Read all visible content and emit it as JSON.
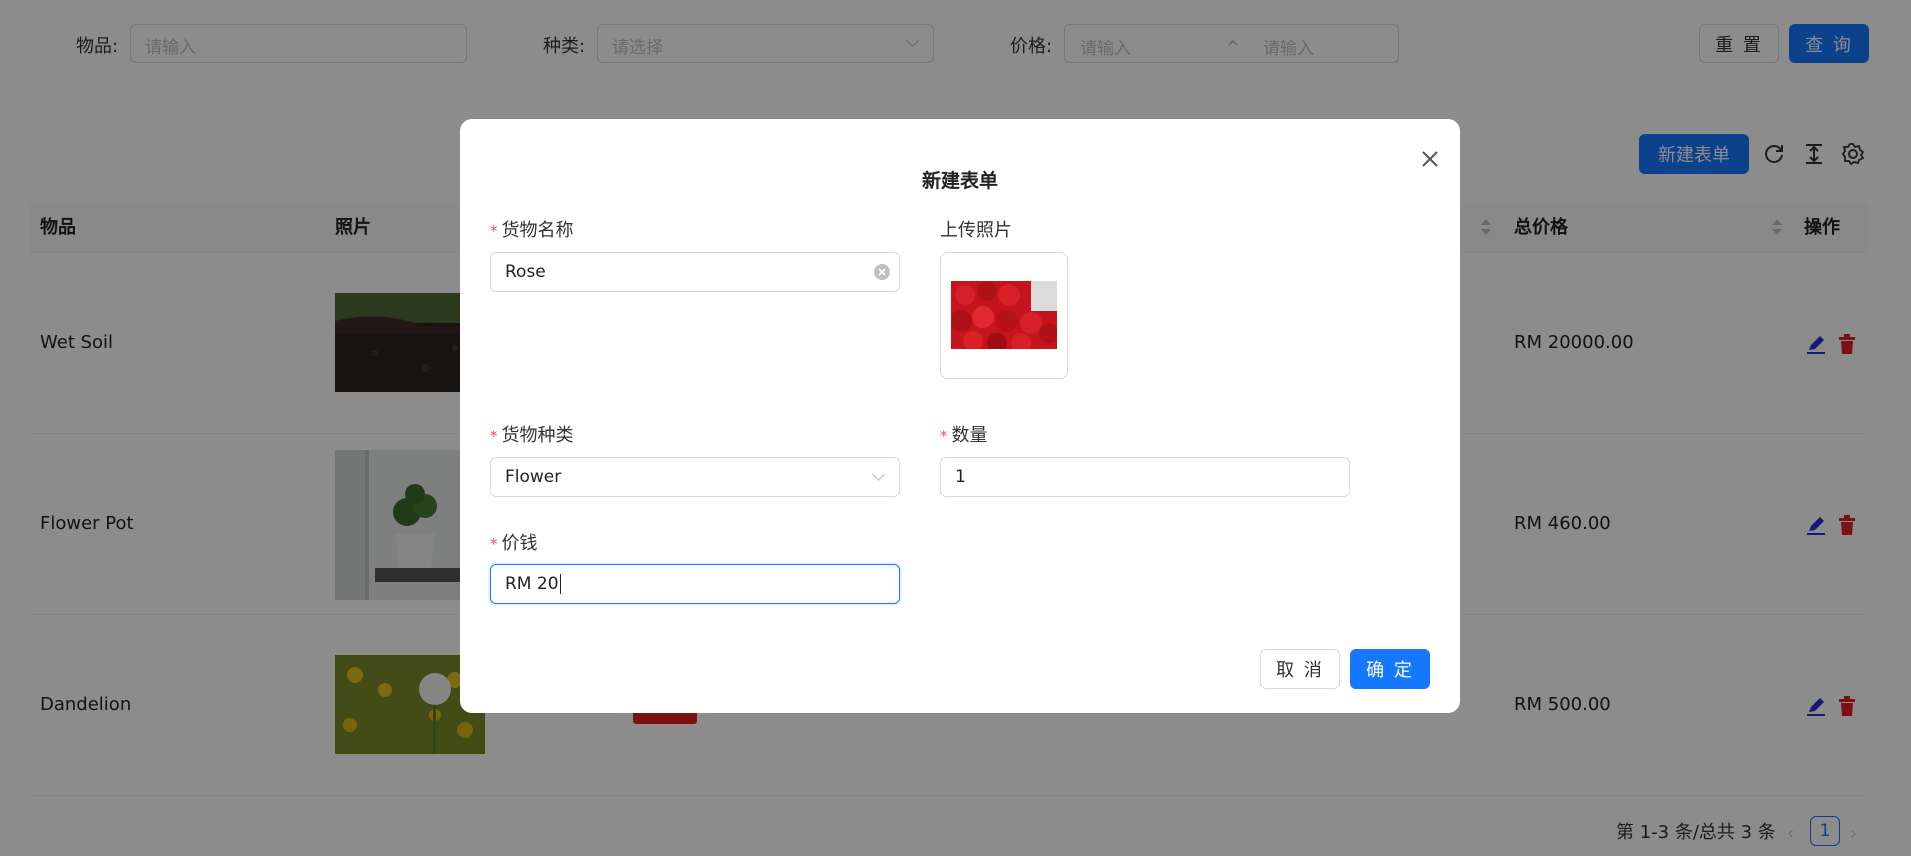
{
  "search": {
    "item_label": "物品:",
    "item_placeholder": "请输入",
    "category_label": "种类:",
    "category_placeholder": "请选择",
    "price_label": "价格:",
    "price_min_placeholder": "请输入",
    "price_max_placeholder": "请输入",
    "reset_label": "重 置",
    "query_label": "查 询"
  },
  "toolbar": {
    "new_label": "新建表单",
    "icons": [
      "reload-icon",
      "density-icon",
      "settings-icon"
    ]
  },
  "table": {
    "headers": {
      "item": "物品",
      "photo": "照片",
      "total_price": "总价格",
      "action": "操作"
    },
    "rows": [
      {
        "item": "Wet Soil",
        "total": "RM 20000.00"
      },
      {
        "item": "Flower Pot",
        "total": "RM 460.00"
      },
      {
        "item": "Dandelion",
        "total": "RM 500.00"
      }
    ]
  },
  "pagination": {
    "summary": "第 1-3 条/总共 3 条",
    "current_page": "1"
  },
  "modal": {
    "title": "新建表单",
    "fields": {
      "name": {
        "label": "货物名称",
        "value": "Rose",
        "required": true
      },
      "photo": {
        "label": "上传照片",
        "required": false
      },
      "category": {
        "label": "货物种类",
        "value": "Flower",
        "required": true
      },
      "quantity": {
        "label": "数量",
        "value": "1",
        "required": true
      },
      "price": {
        "label": "价钱",
        "value": "RM 20",
        "required": true
      }
    },
    "required_mark": "*",
    "cancel_label": "取 消",
    "ok_label": "确 定"
  },
  "colors": {
    "primary": "#1677ff",
    "danger": "#e02020",
    "edit_icon": "#2b2bd8",
    "required_mark": "#ff4d4f"
  }
}
